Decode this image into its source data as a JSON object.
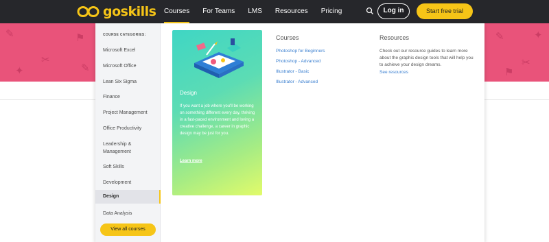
{
  "header": {
    "logo_text": "goskills",
    "nav": [
      "Courses",
      "For Teams",
      "LMS",
      "Resources",
      "Pricing"
    ],
    "login_label": "Log in",
    "trial_label": "Start free trial"
  },
  "menu": {
    "categories_title": "COURSE CATEGORIES:",
    "categories": [
      "Microsoft Excel",
      "Microsoft Office",
      "Lean Six Sigma",
      "Finance",
      "Project Management",
      "Office Productivity",
      "Leadership & Management",
      "Soft Skills",
      "Development",
      "Design",
      "Data Analysis"
    ],
    "active_category": "Design",
    "view_all_label": "View all courses",
    "feature": {
      "title": "Design",
      "description": "If you want a job where you'll be working on something different every day, thriving in a fast-paced environment and loving a creative challenge, a career in graphic design may be just for you.",
      "link": "Learn more"
    },
    "courses": {
      "title": "Courses",
      "items": [
        "Photoshop for Beginners",
        "Photoshop - Advanced",
        "Illustrator - Basic",
        "Illustrator - Advanced"
      ]
    },
    "resources": {
      "title": "Resources",
      "description": "Check out our resource guides to learn more about the graphic design tools that will help you to achieve your design dreams.",
      "link": "See resources"
    }
  },
  "colors": {
    "topbar": "#26272b",
    "accent": "#f6c517",
    "hero": "#e9537a",
    "link": "#3a7fd0"
  }
}
